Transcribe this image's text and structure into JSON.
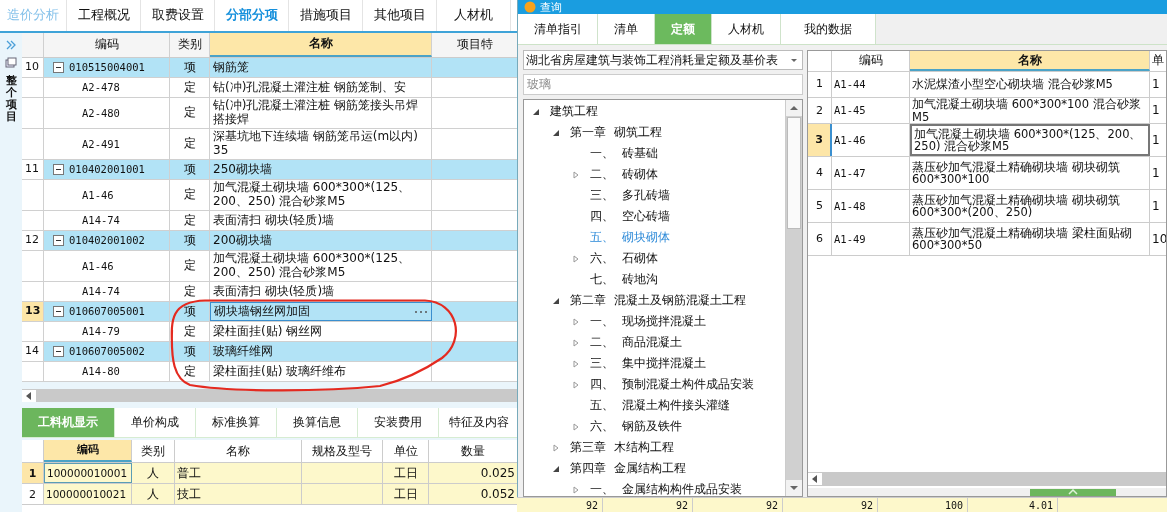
{
  "main": {
    "tabs": [
      {
        "label": "造价分析",
        "kind": "home",
        "selected": false
      },
      {
        "label": "工程概况",
        "kind": "tab",
        "selected": false
      },
      {
        "label": "取费设置",
        "kind": "tab",
        "selected": false
      },
      {
        "label": "分部分项",
        "kind": "tab",
        "selected": true
      },
      {
        "label": "措施项目",
        "kind": "tab",
        "selected": false
      },
      {
        "label": "其他项目",
        "kind": "tab",
        "selected": false
      },
      {
        "label": "人材机",
        "kind": "tab",
        "selected": false
      }
    ],
    "side": {
      "label": "整个项目"
    },
    "table": {
      "columns": [
        "编码",
        "类别",
        "名称",
        "项目特"
      ],
      "rows": [
        {
          "num": "10",
          "code": "010515004001",
          "type": "项",
          "name": "钢筋笼",
          "expanded": true,
          "selected": false,
          "children": [
            {
              "code": "A2-478",
              "type": "定",
              "name": "钻(冲)孔混凝土灌注桩 钢筋笼制、安"
            },
            {
              "code": "A2-480",
              "type": "定",
              "name": "钻(冲)孔混凝土灌注桩 钢筋笼接头吊焊搭接焊"
            },
            {
              "code": "A2-491",
              "type": "定",
              "name": "深基坑地下连续墙 钢筋笼吊运(m以内) 35"
            }
          ]
        },
        {
          "num": "11",
          "code": "010402001001",
          "type": "项",
          "name": "250砌块墙",
          "expanded": true,
          "selected": false,
          "children": [
            {
              "code": "A1-46",
              "type": "定",
              "name": "加气混凝土砌块墙 600*300*(125、200、250) 混合砂浆M5"
            },
            {
              "code": "A14-74",
              "type": "定",
              "name": "表面清扫 砌块(轻质)墙"
            }
          ]
        },
        {
          "num": "12",
          "code": "010402001002",
          "type": "项",
          "name": "200砌块墙",
          "expanded": true,
          "selected": false,
          "children": [
            {
              "code": "A1-46",
              "type": "定",
              "name": "加气混凝土砌块墙 600*300*(125、200、250) 混合砂浆M5"
            },
            {
              "code": "A14-74",
              "type": "定",
              "name": "表面清扫 砌块(轻质)墙"
            }
          ]
        },
        {
          "num": "13",
          "code": "010607005001",
          "type": "项",
          "name": "砌块墙钢丝网加固",
          "expanded": true,
          "selected": true,
          "children": [
            {
              "code": "A14-79",
              "type": "定",
              "name": "梁柱面挂(贴) 钢丝网"
            }
          ]
        },
        {
          "num": "14",
          "code": "010607005002",
          "type": "项",
          "name": "玻璃纤维网",
          "expanded": true,
          "selected": false,
          "children": [
            {
              "code": "A14-80",
              "type": "定",
              "name": "梁柱面挂(贴) 玻璃纤维布"
            }
          ]
        }
      ]
    },
    "bottom_tabs": [
      {
        "label": "工料机显示",
        "selected": true
      },
      {
        "label": "单价构成",
        "selected": false
      },
      {
        "label": "标准换算",
        "selected": false
      },
      {
        "label": "换算信息",
        "selected": false
      },
      {
        "label": "安装费用",
        "selected": false
      },
      {
        "label": "特征及内容",
        "selected": false
      }
    ],
    "bottom_table": {
      "columns": [
        "编码",
        "类别",
        "名称",
        "规格及型号",
        "单位",
        "数量"
      ],
      "rows": [
        {
          "num": "1",
          "code": "100000010001",
          "type": "人",
          "name": "普工",
          "unit": "工日",
          "qty": "0.025",
          "selected": true
        },
        {
          "num": "2",
          "code": "100000010021",
          "type": "人",
          "name": "技工",
          "unit": "工日",
          "qty": "0.052",
          "selected": false
        }
      ]
    }
  },
  "dialog": {
    "title": "查询",
    "tabs": [
      {
        "label": "清单指引",
        "selected": false
      },
      {
        "label": "清单",
        "selected": false
      },
      {
        "label": "定额",
        "selected": true
      },
      {
        "label": "人材机",
        "selected": false
      },
      {
        "label": "我的数据",
        "selected": false
      }
    ],
    "library": "湖北省房屋建筑与装饰工程消耗量定额及基价表",
    "search": {
      "value": "玻璃"
    },
    "tree": [
      {
        "label": "建筑工程",
        "expanded": true,
        "selected": false,
        "children": [
          {
            "label": "第一章  砌筑工程",
            "expanded": true,
            "selected": false,
            "children": [
              {
                "label": "一、  砖基础",
                "selected": false
              },
              {
                "label": "二、  砖砌体",
                "expanded": false,
                "selected": false
              },
              {
                "label": "三、  多孔砖墙",
                "selected": false
              },
              {
                "label": "四、  空心砖墙",
                "selected": false
              },
              {
                "label": "五、  砌块砌体",
                "selected": true
              },
              {
                "label": "六、  石砌体",
                "expanded": false,
                "selected": false
              },
              {
                "label": "七、  砖地沟",
                "selected": false
              }
            ]
          },
          {
            "label": "第二章  混凝土及钢筋混凝土工程",
            "expanded": true,
            "selected": false,
            "children": [
              {
                "label": "一、  现场搅拌混凝土",
                "expanded": false,
                "selected": false
              },
              {
                "label": "二、  商品混凝土",
                "expanded": false,
                "selected": false
              },
              {
                "label": "三、  集中搅拌混凝土",
                "expanded": false,
                "selected": false
              },
              {
                "label": "四、  预制混凝土构件成品安装",
                "expanded": false,
                "selected": false
              },
              {
                "label": "五、  混凝土构件接头灌缝",
                "selected": false
              },
              {
                "label": "六、  钢筋及铁件",
                "expanded": false,
                "selected": false
              }
            ]
          },
          {
            "label": "第三章  木结构工程",
            "expanded": false,
            "selected": false
          },
          {
            "label": "第四章  金属结构工程",
            "expanded": true,
            "selected": false,
            "children": [
              {
                "label": "一、  金属结构构件成品安装",
                "expanded": false,
                "selected": false
              }
            ]
          }
        ]
      }
    ],
    "table": {
      "columns": [
        "编码",
        "名称",
        "单"
      ],
      "rows": [
        {
          "num": "1",
          "code": "A1-44",
          "name": "水泥煤渣小型空心砌块墙 混合砂浆M5",
          "unit": "1",
          "selected": false
        },
        {
          "num": "2",
          "code": "A1-45",
          "name": "加气混凝土砌块墙 600*300*100 混合砂浆M5",
          "unit": "1",
          "selected": false
        },
        {
          "num": "3",
          "code": "A1-46",
          "name": "加气混凝土砌块墙 600*300*(125、200、250) 混合砂浆M5",
          "unit": "1",
          "selected": true
        },
        {
          "num": "4",
          "code": "A1-47",
          "name": "蒸压砂加气混凝土精确砌块墙 砌块砌筑 600*300*100",
          "unit": "1",
          "selected": false
        },
        {
          "num": "5",
          "code": "A1-48",
          "name": "蒸压砂加气混凝土精确砌块墙 砌块砌筑 600*300*(200、250)",
          "unit": "1",
          "selected": false
        },
        {
          "num": "6",
          "code": "A1-49",
          "name": "蒸压砂加气混凝土精确砌块墙 梁柱面贴砌 600*300*50",
          "unit": "10",
          "selected": false
        }
      ]
    }
  },
  "behind_cells": [
    "92",
    "92",
    "92",
    "92",
    "100",
    "4.01"
  ]
}
